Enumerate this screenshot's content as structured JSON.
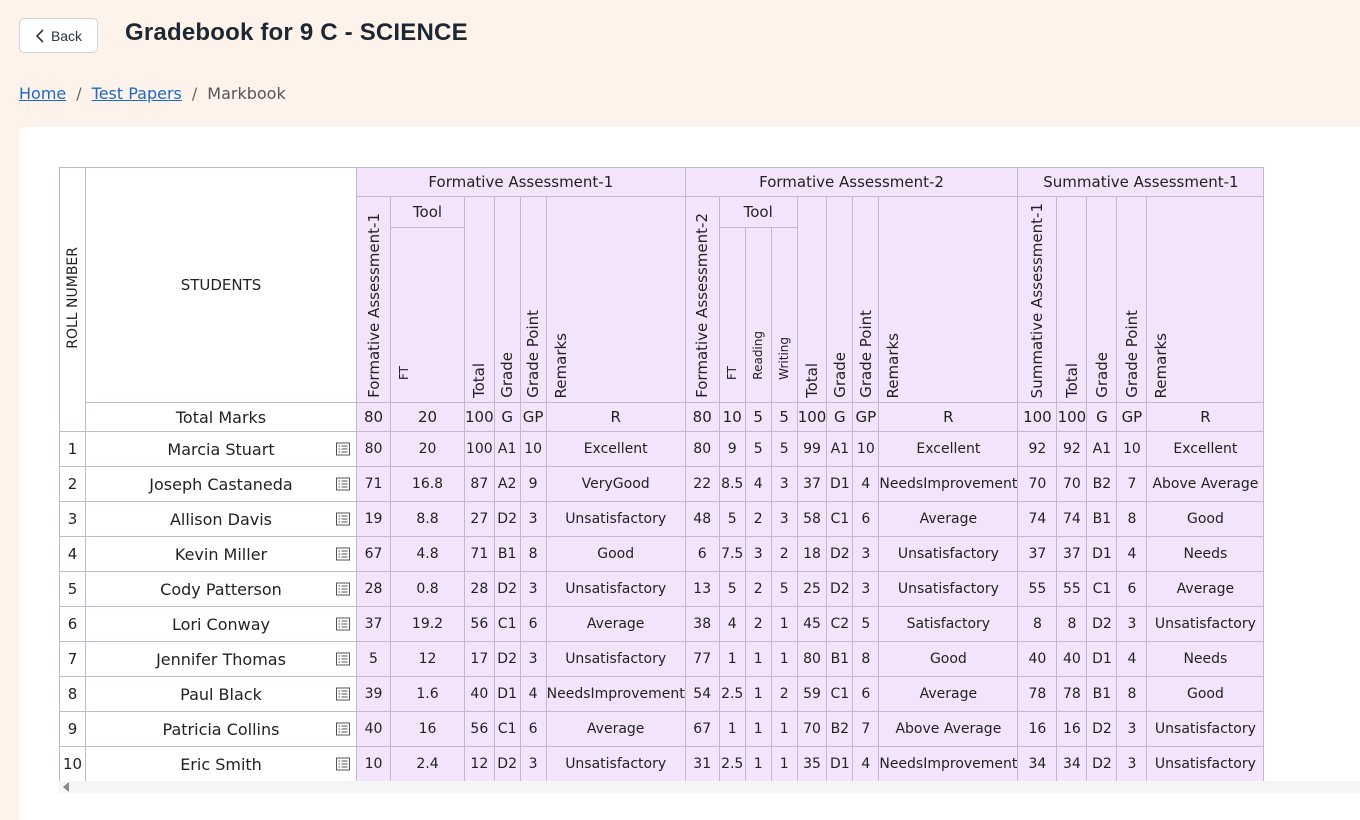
{
  "header": {
    "back_label": "Back",
    "title": "Gradebook for 9 C - SCIENCE"
  },
  "breadcrumb": {
    "items": [
      "Home",
      "Test Papers",
      "Markbook"
    ]
  },
  "table": {
    "roll_header": "ROLL NUMBER",
    "students_header": "STUDENTS",
    "total_marks_label": "Total Marks",
    "groups": [
      {
        "title": "Formative Assessment-1",
        "tool_label": "Tool",
        "columns": [
          "Formative Assessment-1",
          "FT",
          "Total",
          "Grade",
          "Grade Point",
          "Remarks"
        ],
        "max_marks": [
          "80",
          "20",
          "100",
          "G",
          "GP",
          "R"
        ]
      },
      {
        "title": "Formative Assessment-2",
        "tool_label": "Tool",
        "columns": [
          "Formative Assessment-2",
          "FT",
          "Reading",
          "Writing",
          "Total",
          "Grade",
          "Grade Point",
          "Remarks"
        ],
        "max_marks": [
          "80",
          "10",
          "5",
          "5",
          "100",
          "G",
          "GP",
          "R"
        ]
      },
      {
        "title": "Summative Assessment-1",
        "columns": [
          "Summative Assessment-1",
          "Total",
          "Grade",
          "Grade Point",
          "Remarks"
        ],
        "max_marks": [
          "100",
          "100",
          "G",
          "GP",
          "R"
        ]
      }
    ],
    "rows": [
      {
        "roll": "1",
        "name": "Marcia Stuart",
        "cells": [
          "80",
          "20",
          "100",
          "A1",
          "10",
          "Excellent",
          "80",
          "9",
          "5",
          "5",
          "99",
          "A1",
          "10",
          "Excellent",
          "92",
          "92",
          "A1",
          "10",
          "Excellent"
        ]
      },
      {
        "roll": "2",
        "name": "Joseph Castaneda",
        "cells": [
          "71",
          "16.8",
          "87",
          "A2",
          "9",
          "VeryGood",
          "22",
          "8.5",
          "4",
          "3",
          "37",
          "D1",
          "4",
          "NeedsImprovement",
          "70",
          "70",
          "B2",
          "7",
          "Above Average"
        ]
      },
      {
        "roll": "3",
        "name": "Allison Davis",
        "cells": [
          "19",
          "8.8",
          "27",
          "D2",
          "3",
          "Unsatisfactory",
          "48",
          "5",
          "2",
          "3",
          "58",
          "C1",
          "6",
          "Average",
          "74",
          "74",
          "B1",
          "8",
          "Good"
        ]
      },
      {
        "roll": "4",
        "name": "Kevin Miller",
        "cells": [
          "67",
          "4.8",
          "71",
          "B1",
          "8",
          "Good",
          "6",
          "7.5",
          "3",
          "2",
          "18",
          "D2",
          "3",
          "Unsatisfactory",
          "37",
          "37",
          "D1",
          "4",
          "Needs"
        ]
      },
      {
        "roll": "5",
        "name": "Cody Patterson",
        "cells": [
          "28",
          "0.8",
          "28",
          "D2",
          "3",
          "Unsatisfactory",
          "13",
          "5",
          "2",
          "5",
          "25",
          "D2",
          "3",
          "Unsatisfactory",
          "55",
          "55",
          "C1",
          "6",
          "Average"
        ]
      },
      {
        "roll": "6",
        "name": "Lori Conway",
        "cells": [
          "37",
          "19.2",
          "56",
          "C1",
          "6",
          "Average",
          "38",
          "4",
          "2",
          "1",
          "45",
          "C2",
          "5",
          "Satisfactory",
          "8",
          "8",
          "D2",
          "3",
          "Unsatisfactory"
        ]
      },
      {
        "roll": "7",
        "name": "Jennifer Thomas",
        "cells": [
          "5",
          "12",
          "17",
          "D2",
          "3",
          "Unsatisfactory",
          "77",
          "1",
          "1",
          "1",
          "80",
          "B1",
          "8",
          "Good",
          "40",
          "40",
          "D1",
          "4",
          "Needs"
        ]
      },
      {
        "roll": "8",
        "name": "Paul Black",
        "cells": [
          "39",
          "1.6",
          "40",
          "D1",
          "4",
          "NeedsImprovement",
          "54",
          "2.5",
          "1",
          "2",
          "59",
          "C1",
          "6",
          "Average",
          "78",
          "78",
          "B1",
          "8",
          "Good"
        ]
      },
      {
        "roll": "9",
        "name": "Patricia Collins",
        "cells": [
          "40",
          "16",
          "56",
          "C1",
          "6",
          "Average",
          "67",
          "1",
          "1",
          "1",
          "70",
          "B2",
          "7",
          "Above Average",
          "16",
          "16",
          "D2",
          "3",
          "Unsatisfactory"
        ]
      },
      {
        "roll": "10",
        "name": "Eric Smith",
        "cells": [
          "10",
          "2.4",
          "12",
          "D2",
          "3",
          "Unsatisfactory",
          "31",
          "2.5",
          "1",
          "1",
          "35",
          "D1",
          "4",
          "NeedsImprovement",
          "34",
          "34",
          "D2",
          "3",
          "Unsatisfactory"
        ]
      }
    ]
  }
}
